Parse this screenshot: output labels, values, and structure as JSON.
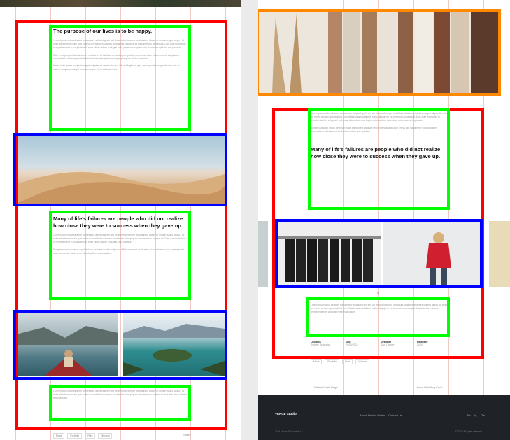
{
  "left": {
    "heading1": "The purpose of our lives is to be happy.",
    "para1a": "Lorem ipsum dolor sit amet consectetur adipiscing elit sed do eiusmod tempor incididunt ut labore et dolore magna aliqua. Ut enim ad minim veniam quis nostrud exercitation ullamco laboris nisi ut aliquip ex ea commodo consequat. Duis aute irure dolor in reprehenderit in voluptate velit esse cillum dolore eu fugiat nulla pariatur excepteur sint occaecat cupidatat non proident.",
    "para1b": "Sunt in culpa qui officia deserunt mollit anim id est laborum sed ut perspiciatis unde omnis iste natus error sit voluptatem accusantium doloremque laudantium totam rem aperiam eaque ipsa quae ab illo inventore.",
    "para1c": "Nemo enim ipsam voluptatem quia voluptas sit aspernatur aut odit aut fugit sed quia consequuntur magni dolores eos qui ratione voluptatem sequi nesciunt neque porro quisquam est.",
    "heading2": "Many of life's failures are people who did not realize how close they were to success when they gave up.",
    "para2a": "Lorem ipsum dolor sit amet consectetur adipiscing elit sed do eiusmod tempor incididunt ut labore et dolore magna aliqua. Ut enim ad minim veniam quis nostrud exercitation ullamco laboris nisi ut aliquip ex ea commodo consequat. Duis aute irure dolor in reprehenderit in voluptate velit esse cillum dolore eu fugiat nulla pariatur.",
    "para2b": "Excepteur sint occaecat cupidatat non proident sunt in culpa qui officia deserunt mollit anim id est laborum sed ut perspiciatis unde omnis iste natus error sit voluptatem accusantium.",
    "para3": "Lorem ipsum dolor sit amet consectetur adipiscing elit sed do eiusmod tempor incididunt ut labore et dolore magna aliqua. Ut enim ad minim veniam quis nostrud exercitation ullamco laboris nisi ut aliquip ex ea commodo consequat duis aute irure dolor in reprehenderit.",
    "tags": [
      "Mock",
      "Portfolio",
      "Print",
      "Minimal"
    ],
    "share_label": "Share"
  },
  "right": {
    "para1a": "Lorem ipsum dolor sit amet consectetur adipiscing elit sed do eiusmod tempor incididunt ut labore et dolore magna aliqua. Ut enim ad minim veniam quis nostrud exercitation ullamco laboris nisi ut aliquip ex ea commodo consequat. Duis aute irure dolor in reprehenderit in voluptate velit esse cillum dolore eu fugiat nulla pariatur excepteur sint occaecat cupidatat.",
    "para1b": "Sunt in culpa qui officia deserunt mollit anim id est laborum sed ut perspiciatis unde omnis iste natus error sit voluptatem accusantium doloremque laudantium totam rem aperiam.",
    "heading": "Many of life's failures are people who did not realize how close they were to success when they gave up.",
    "para2": "Lorem ipsum dolor sit amet consectetur adipiscing elit sed do eiusmod tempor incididunt ut labore et dolore magna aliqua. Ut enim ad minim veniam quis nostrud exercitation ullamco laboris nisi ut aliquip ex ea commodo consequat duis aute irure dolor in reprehenderit in voluptate velit esse cillum.",
    "meta": [
      {
        "label": "Location",
        "value": "Sydney, Australia"
      },
      {
        "label": "Date",
        "value": "24/03/2024"
      },
      {
        "label": "Designer",
        "value": "Sam Cooper"
      },
      {
        "label": "Released",
        "value": "2024"
      }
    ],
    "tags": [
      "Mock",
      "Portfolio",
      "Print",
      "Minimal"
    ],
    "prev_label": "← Minimal Web Dsgn",
    "next_label": "Vence Wedding Card →",
    "footer": {
      "brand": "VENCE Studio.",
      "links": [
        "About Studio",
        "Works",
        "Contact Us"
      ],
      "socials": [
        "Fb",
        "Ig",
        "Tw"
      ],
      "copyright": "2024 Vence Studio Web UI",
      "rights": "© 2024 All rights reserved"
    }
  }
}
